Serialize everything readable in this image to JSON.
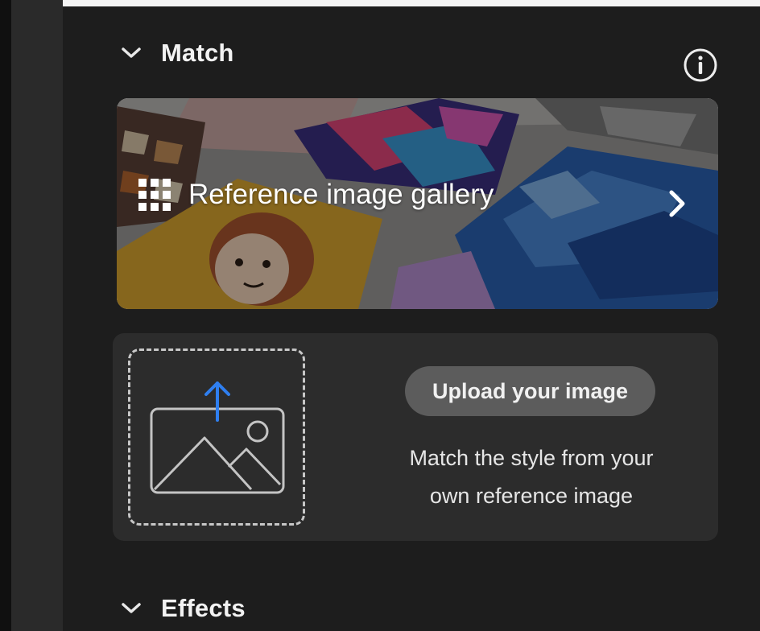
{
  "match_section": {
    "title": "Match",
    "chevron_icon": "chevron-down-icon",
    "info_icon": "info-icon"
  },
  "reference_gallery": {
    "label": "Reference image gallery",
    "icon": "grid-icon",
    "arrow_icon": "chevron-right-icon"
  },
  "upload": {
    "button_label": "Upload your image",
    "description_line1": "Match the style from your",
    "description_line2": "own reference image",
    "icon": "image-upload-icon",
    "accent_color": "#2f7ff0"
  },
  "effects_section": {
    "title": "Effects",
    "chevron_icon": "chevron-down-icon"
  }
}
